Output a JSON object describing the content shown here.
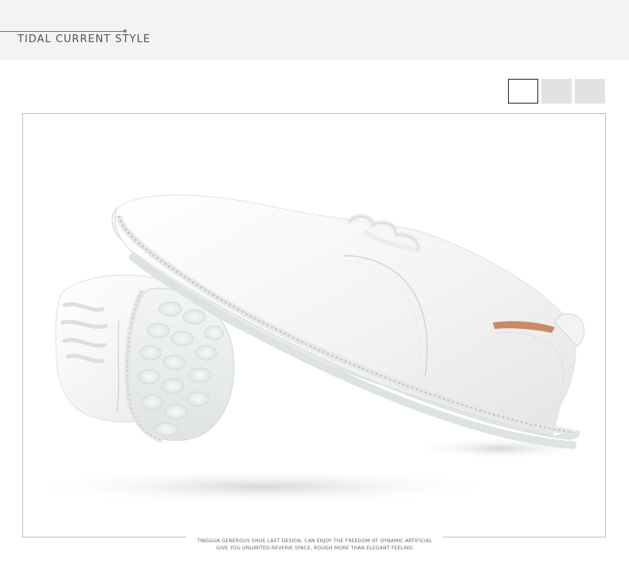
{
  "header": {
    "title": "TIDAL CURRENT STYLE"
  },
  "color_options": [
    {
      "name": "white",
      "color": "#ffffff",
      "selected": true
    },
    {
      "name": "light-gray",
      "color": "#e2e2e2",
      "selected": false
    },
    {
      "name": "light-gray-2",
      "color": "#e2e2e2",
      "selected": false
    }
  ],
  "product_image": {
    "subject": "white leather lace-up shoes with translucent sole",
    "colors": {
      "background": "#ffffff",
      "leather": "#f4f4f4",
      "sole": "#e9ecec",
      "shadow": "#d9d9d9",
      "lining": "#c98a6a"
    }
  },
  "caption": {
    "line1": "TINGGUA GENEROUS SHOE LAST DESIGN, CAN ENJOY THE FREEDOM OF DYNAMIC ARTIFICIAL",
    "line2": "GIVE YOU UNLIMITED REVERIE SPACE, ROUGH MORE THAN ELEGANT FEELING"
  }
}
